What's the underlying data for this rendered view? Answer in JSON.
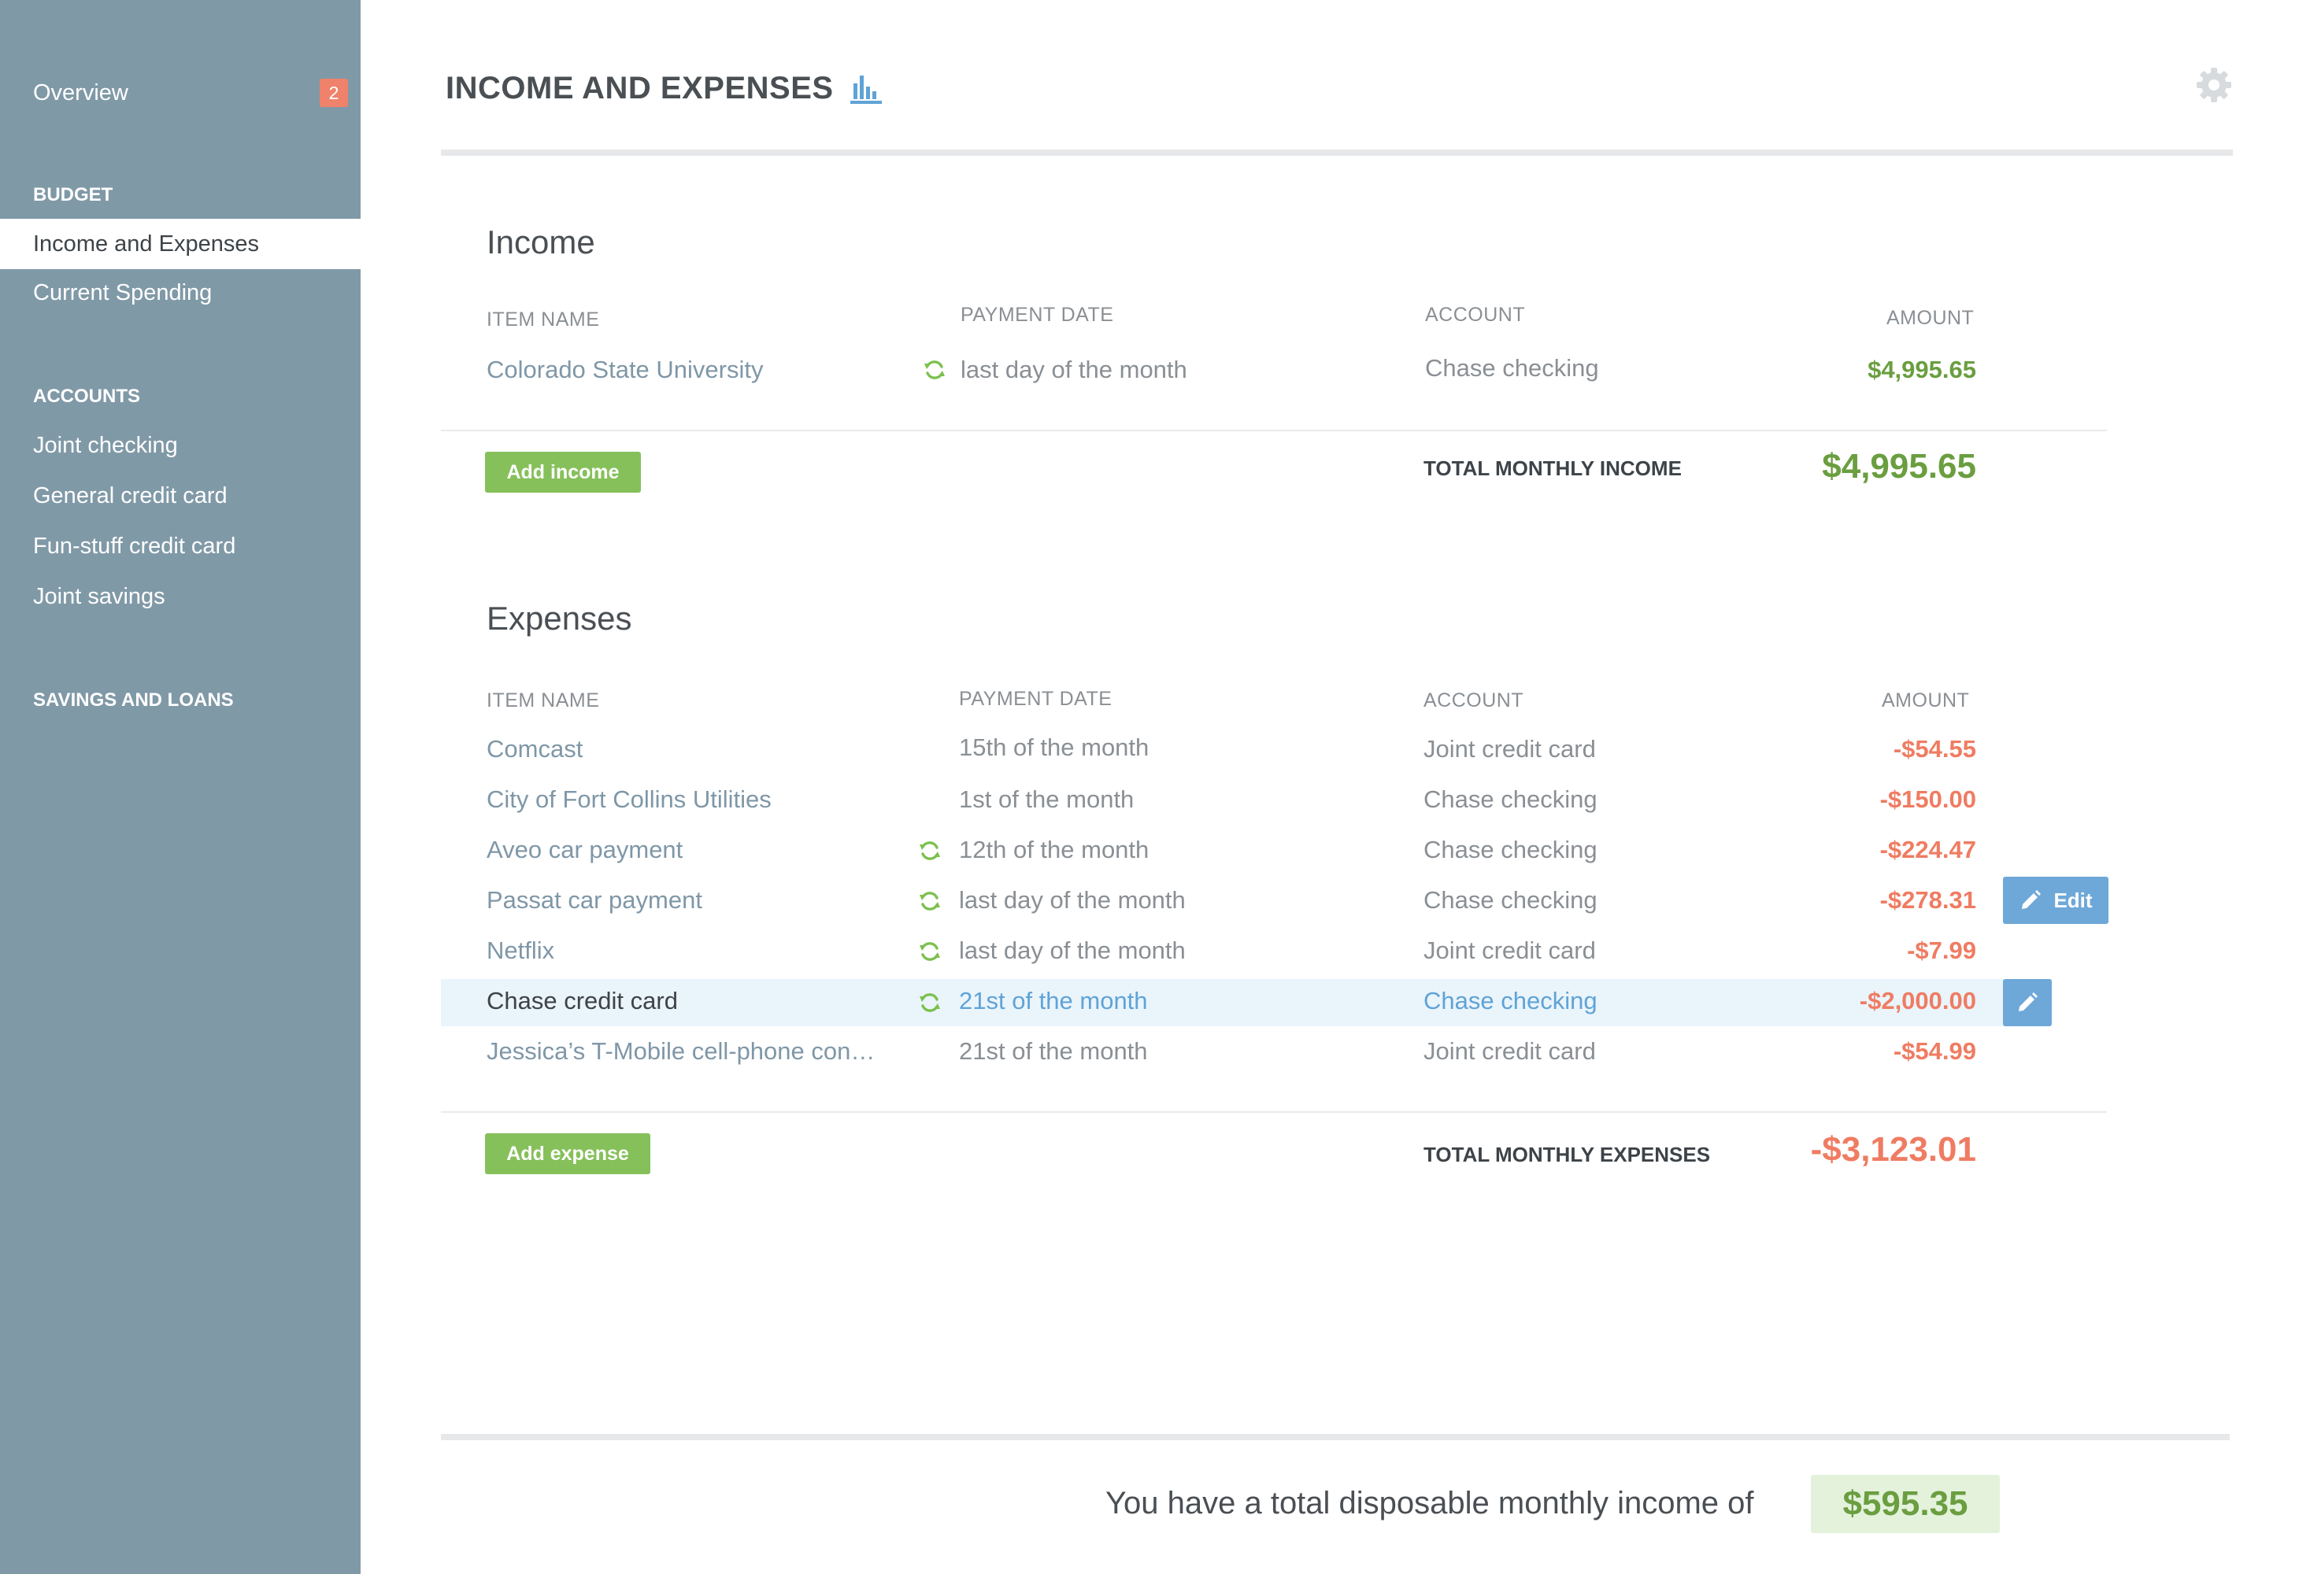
{
  "sidebar": {
    "overview_label": "Overview",
    "overview_badge": "2",
    "budget_heading": "BUDGET",
    "budget_items": [
      "Income and Expenses",
      "Current Spending"
    ],
    "accounts_heading": "ACCOUNTS",
    "accounts_items": [
      "Joint checking",
      "General credit card",
      "Fun-stuff credit card",
      "Joint savings"
    ],
    "savings_heading": "SAVINGS AND LOANS"
  },
  "header": {
    "title": "INCOME AND EXPENSES",
    "chart_icon": "bar-chart-icon",
    "settings_icon": "gear-icon"
  },
  "income": {
    "title": "Income",
    "columns": [
      "ITEM NAME",
      "PAYMENT DATE",
      "ACCOUNT",
      "AMOUNT"
    ],
    "rows": [
      {
        "name": "Colorado State University",
        "recurring": true,
        "date": "last day of the month",
        "account": "Chase checking",
        "amount": "$4,995.65"
      }
    ],
    "add_label": "Add income",
    "total_label": "TOTAL MONTHLY INCOME",
    "total_value": "$4,995.65"
  },
  "expenses": {
    "title": "Expenses",
    "columns": [
      "ITEM NAME",
      "PAYMENT DATE",
      "ACCOUNT",
      "AMOUNT"
    ],
    "rows": [
      {
        "name": "Comcast",
        "recurring": false,
        "date": "15th of the month",
        "account": "Joint credit card",
        "amount": "-$54.55"
      },
      {
        "name": "City of Fort Collins Utilities",
        "recurring": false,
        "date": "1st of the month",
        "account": "Chase checking",
        "amount": "-$150.00"
      },
      {
        "name": "Aveo car payment",
        "recurring": true,
        "date": "12th of the month",
        "account": "Chase checking",
        "amount": "-$224.47"
      },
      {
        "name": "Passat car payment",
        "recurring": true,
        "date": "last day of the month",
        "account": "Chase checking",
        "amount": "-$278.31"
      },
      {
        "name": "Netflix",
        "recurring": true,
        "date": "last day of the month",
        "account": "Joint credit card",
        "amount": "-$7.99"
      },
      {
        "name": "Chase credit card",
        "recurring": true,
        "date": "21st of the month",
        "account": "Chase checking",
        "amount": "-$2,000.00"
      },
      {
        "name": "Jessica’s T-Mobile cell-phone con…",
        "recurring": false,
        "date": "21st of the month",
        "account": "Joint credit card",
        "amount": "-$54.99"
      }
    ],
    "edit_label": "Edit",
    "add_label": "Add expense",
    "total_label": "TOTAL MONTHLY EXPENSES",
    "total_value": "-$3,123.01"
  },
  "footer": {
    "text": "You have a total disposable monthly income of",
    "value": "$595.35"
  },
  "colors": {
    "sidebar": "#8099a7",
    "positive": "#6a9e40",
    "negative": "#ef7c62",
    "accent_blue": "#6ea8d8",
    "button_green": "#86c05a"
  }
}
